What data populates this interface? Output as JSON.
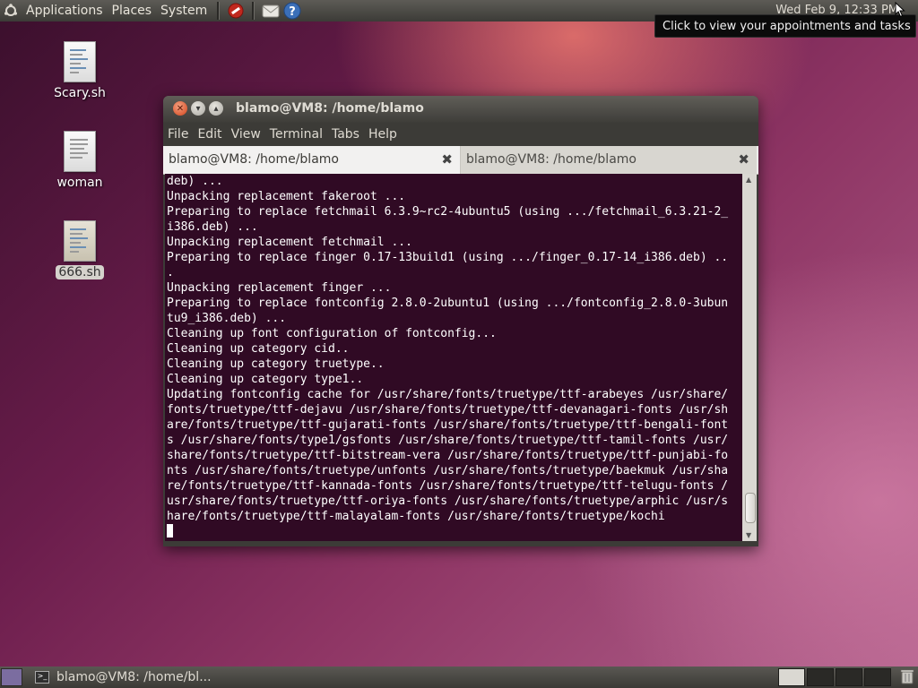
{
  "top_panel": {
    "menus": [
      "Applications",
      "Places",
      "System"
    ],
    "clock": "Wed Feb  9, 12:33 PM",
    "tooltip": "Click to view your appointments and tasks"
  },
  "desktop_icons": [
    {
      "label": "Scary.sh"
    },
    {
      "label": "woman"
    },
    {
      "label": "666.sh"
    }
  ],
  "window": {
    "title": "blamo@VM8: /home/blamo",
    "menu": [
      "File",
      "Edit",
      "View",
      "Terminal",
      "Tabs",
      "Help"
    ],
    "tabs": [
      {
        "label": "blamo@VM8: /home/blamo"
      },
      {
        "label": "blamo@VM8: /home/blamo"
      }
    ],
    "terminal_lines": [
      "deb) ...",
      "Unpacking replacement fakeroot ...",
      "Preparing to replace fetchmail 6.3.9~rc2-4ubuntu5 (using .../fetchmail_6.3.21-2_",
      "i386.deb) ...",
      "Unpacking replacement fetchmail ...",
      "Preparing to replace finger 0.17-13build1 (using .../finger_0.17-14_i386.deb) ..",
      ".",
      "Unpacking replacement finger ...",
      "Preparing to replace fontconfig 2.8.0-2ubuntu1 (using .../fontconfig_2.8.0-3ubun",
      "tu9_i386.deb) ...",
      "Cleaning up font configuration of fontconfig...",
      "Cleaning up category cid..",
      "Cleaning up category truetype..",
      "Cleaning up category type1..",
      "Updating fontconfig cache for /usr/share/fonts/truetype/ttf-arabeyes /usr/share/",
      "fonts/truetype/ttf-dejavu /usr/share/fonts/truetype/ttf-devanagari-fonts /usr/sh",
      "are/fonts/truetype/ttf-gujarati-fonts /usr/share/fonts/truetype/ttf-bengali-font",
      "s /usr/share/fonts/type1/gsfonts /usr/share/fonts/truetype/ttf-tamil-fonts /usr/",
      "share/fonts/truetype/ttf-bitstream-vera /usr/share/fonts/truetype/ttf-punjabi-fo",
      "nts /usr/share/fonts/truetype/unfonts /usr/share/fonts/truetype/baekmuk /usr/sha",
      "re/fonts/truetype/ttf-kannada-fonts /usr/share/fonts/truetype/ttf-telugu-fonts /",
      "usr/share/fonts/truetype/ttf-oriya-fonts /usr/share/fonts/truetype/arphic /usr/s",
      "hare/fonts/truetype/ttf-malayalam-fonts /usr/share/fonts/truetype/kochi"
    ]
  },
  "bottom_panel": {
    "task_label": "blamo@VM8: /home/bl..."
  },
  "colors": {
    "terminal_bg": "#300a24",
    "panel": "#3c3b37",
    "close_button": "#d1441c"
  },
  "icons": [
    "ubuntu-logo-icon",
    "no-entry-icon",
    "mail-icon",
    "help-icon",
    "close-icon",
    "minimize-icon",
    "maximize-icon",
    "terminal-icon",
    "trash-icon",
    "mouse-cursor-icon"
  ]
}
